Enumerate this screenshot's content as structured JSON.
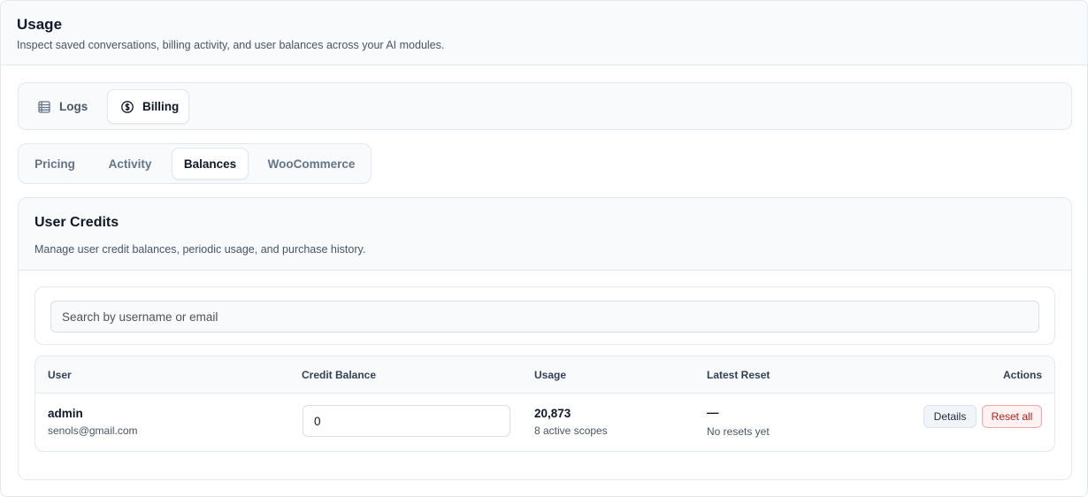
{
  "header": {
    "title": "Usage",
    "subtitle": "Inspect saved conversations, billing activity, and user balances across your AI modules."
  },
  "module_tabs": [
    {
      "label": "Logs",
      "icon": "table-list-icon",
      "active": false
    },
    {
      "label": "Billing",
      "icon": "dollar-circle-icon",
      "active": true
    }
  ],
  "sub_tabs": [
    {
      "label": "Pricing",
      "active": false
    },
    {
      "label": "Activity",
      "active": false
    },
    {
      "label": "Balances",
      "active": true
    },
    {
      "label": "WooCommerce",
      "active": false
    }
  ],
  "card": {
    "title": "User Credits",
    "description": "Manage user credit balances, periodic usage, and purchase history."
  },
  "search": {
    "placeholder": "Search by username or email",
    "value": ""
  },
  "table": {
    "columns": [
      "User",
      "Credit Balance",
      "Usage",
      "Latest Reset",
      "Actions"
    ],
    "rows": [
      {
        "user_name": "admin",
        "user_email": "senols@gmail.com",
        "credit_balance": "0",
        "usage_value": "20,873",
        "usage_sub": "8 active scopes",
        "latest_reset": "—",
        "latest_reset_sub": "No resets yet",
        "actions": {
          "details": "Details",
          "reset": "Reset all"
        }
      }
    ]
  },
  "colors": {
    "accent_danger": "#b91c1c",
    "border": "#e2e8f0",
    "muted_bg": "#f8fafc"
  }
}
